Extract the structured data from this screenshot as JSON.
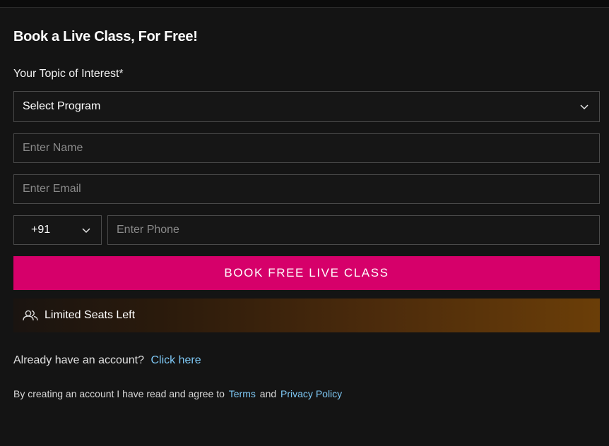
{
  "form": {
    "title": "Book a Live Class, For Free!",
    "topic_label": "Your Topic of Interest*",
    "program_select": {
      "value": "Select Program"
    },
    "name_input": {
      "placeholder": "Enter Name"
    },
    "email_input": {
      "placeholder": "Enter Email"
    },
    "country_code": {
      "value": "+91"
    },
    "phone_input": {
      "placeholder": "Enter Phone"
    },
    "submit_label": "BOOK FREE LIVE CLASS",
    "seats_text": "Limited Seats Left",
    "seats_icon": "users-icon"
  },
  "footer": {
    "account_prompt": "Already have an account?",
    "account_link": "Click here",
    "consent_text": "By creating an account I have read and agree to",
    "terms_link": "Terms",
    "and_text": "and",
    "privacy_link": "Privacy Policy"
  },
  "colors": {
    "background": "#141414",
    "accent": "#d6006a",
    "link": "#7ec8f5"
  }
}
